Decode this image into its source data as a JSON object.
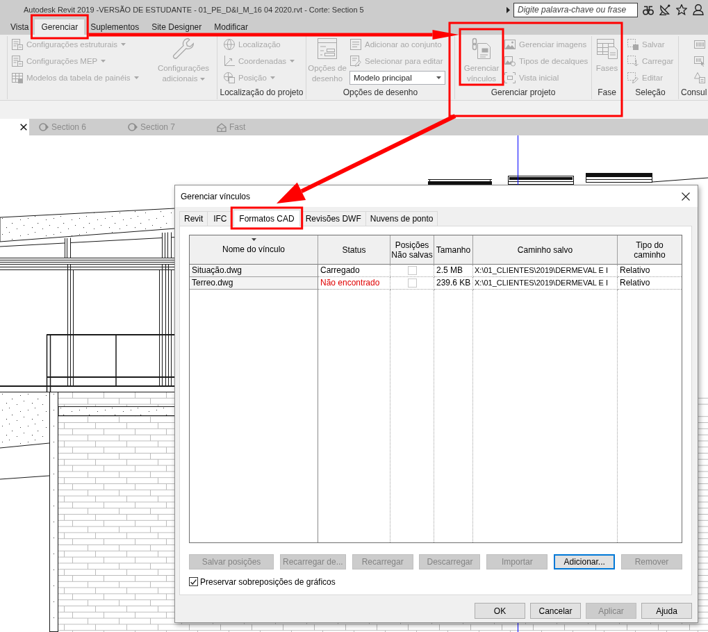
{
  "window": {
    "title": "Autodesk Revit 2019 -VERSÃO DE ESTUDANTE - 01_PE_D&I_M_16 04 2020.rvt - Corte: Section 5"
  },
  "search": {
    "placeholder": "Digite palavra-chave ou frase"
  },
  "ribbon_tabs": [
    {
      "label": "Vista",
      "selected": false
    },
    {
      "label": "Gerenciar",
      "selected": true
    },
    {
      "label": "Suplementos",
      "selected": false
    },
    {
      "label": "Site Designer",
      "selected": false
    },
    {
      "label": "Modificar",
      "selected": false
    }
  ],
  "ribbon_panels": [
    {
      "items": [
        {
          "kind": "small",
          "label": "Configurações estruturais",
          "dropdown": true,
          "disabled": true
        },
        {
          "kind": "small",
          "label": "Configurações MEP",
          "dropdown": true,
          "disabled": true
        },
        {
          "kind": "small",
          "label": "Modelos da tabela de painéis",
          "dropdown": true,
          "disabled": true
        },
        {
          "kind": "large",
          "label": "Configurações adicionais",
          "dropdown": true,
          "disabled": true
        }
      ]
    },
    {
      "label": "Localização do projeto",
      "items": [
        {
          "kind": "small",
          "label": "Localização",
          "dropdown": false,
          "disabled": true
        },
        {
          "kind": "small",
          "label": "Coordenadas",
          "dropdown": true,
          "disabled": true
        },
        {
          "kind": "small",
          "label": "Posição",
          "dropdown": true,
          "disabled": true
        }
      ]
    },
    {
      "label": "Opções de desenho",
      "items": [
        {
          "kind": "large",
          "label": "Opções de desenho",
          "dropdown": false,
          "disabled": true
        },
        {
          "kind": "small",
          "label": "Adicionar ao conjunto",
          "dropdown": false,
          "disabled": true
        },
        {
          "kind": "small",
          "label": "Selecionar para editar",
          "dropdown": false,
          "disabled": true
        },
        {
          "kind": "combo",
          "value": "Modelo principal",
          "dropdown": true,
          "disabled": false
        }
      ]
    },
    {
      "label": "Gerenciar projeto",
      "items": [
        {
          "kind": "large",
          "label": "Gerenciar vínculos",
          "dropdown": false,
          "disabled": true
        },
        {
          "kind": "small",
          "label": "Gerenciar imagens",
          "dropdown": false,
          "disabled": true
        },
        {
          "kind": "small",
          "label": "Tipos de decalques",
          "dropdown": false,
          "disabled": true
        },
        {
          "kind": "small",
          "label": "Vista inicial",
          "dropdown": false,
          "disabled": true
        }
      ]
    },
    {
      "label": "Fase",
      "items": [
        {
          "kind": "large",
          "label": "Fases",
          "dropdown": false,
          "disabled": true
        }
      ]
    },
    {
      "label": "Seleção",
      "items": [
        {
          "kind": "small",
          "label": "Salvar",
          "dropdown": false,
          "disabled": true
        },
        {
          "kind": "small",
          "label": "Carregar",
          "dropdown": false,
          "disabled": true
        },
        {
          "kind": "small",
          "label": "Editar",
          "dropdown": false,
          "disabled": true
        }
      ]
    },
    {
      "label": "Consul",
      "items": [
        {
          "kind": "icon",
          "dropdown": false,
          "disabled": true
        },
        {
          "kind": "icon",
          "dropdown": false,
          "disabled": true
        },
        {
          "kind": "icon",
          "dropdown": false,
          "disabled": true
        }
      ]
    }
  ],
  "view_tabs": [
    {
      "selected": true
    },
    {
      "label": "Section 6",
      "kind": "section",
      "selected": false
    },
    {
      "label": "Section 7",
      "kind": "section",
      "selected": false
    },
    {
      "label": "Fast",
      "kind": "model",
      "selected": false
    }
  ],
  "dialog": {
    "title": "Gerenciar vínculos",
    "tabs": [
      {
        "label": "Revit",
        "selected": false
      },
      {
        "label": "IFC",
        "selected": false
      },
      {
        "label": "Formatos CAD",
        "selected": true
      },
      {
        "label": "Revisões DWF",
        "selected": false
      },
      {
        "label": "Nuvens de ponto",
        "selected": false
      }
    ],
    "table": {
      "columns": [
        {
          "label": "Nome do vínculo",
          "sorted": true
        },
        {
          "label": "Status",
          "sorted": false
        },
        {
          "label": "Posições Não salvas",
          "sorted": false
        },
        {
          "label": "Tamanho",
          "sorted": false
        },
        {
          "label": "Caminho salvo",
          "sorted": false
        },
        {
          "label": "Tipo do caminho",
          "sorted": false
        }
      ],
      "rows": [
        {
          "name": "Situação.dwg",
          "status": "Carregado",
          "found": true,
          "unsaved_positions": false,
          "size": "2.5 MB",
          "saved_path": "X:\\01_CLIENTES\\2019\\DERMEVAL E I",
          "path_type": "Relativo"
        },
        {
          "name": "Terreo.dwg",
          "status": "Não encontrado",
          "found": false,
          "unsaved_positions": false,
          "size": "239.6 KB",
          "saved_path": "X:\\01_CLIENTES\\2019\\DERMEVAL E I",
          "path_type": "Relativo"
        }
      ]
    },
    "buttons": [
      {
        "label": "Salvar posições",
        "disabled": true,
        "focused": false
      },
      {
        "label": "Recarregar de...",
        "disabled": true,
        "focused": false
      },
      {
        "label": "Recarregar",
        "disabled": true,
        "focused": false
      },
      {
        "label": "Descarregar",
        "disabled": true,
        "focused": false
      },
      {
        "label": "Importar",
        "disabled": true,
        "focused": false
      },
      {
        "label": "Adicionar...",
        "disabled": false,
        "focused": true
      },
      {
        "label": "Remover",
        "disabled": true,
        "focused": false
      }
    ],
    "option": {
      "label": "Preservar sobreposições de gráficos",
      "checked": true
    },
    "footer_buttons": [
      {
        "label": "OK",
        "disabled": false
      },
      {
        "label": "Cancelar",
        "disabled": false
      },
      {
        "label": "Aplicar",
        "disabled": true
      },
      {
        "label": "Ajuda",
        "disabled": false
      }
    ]
  }
}
